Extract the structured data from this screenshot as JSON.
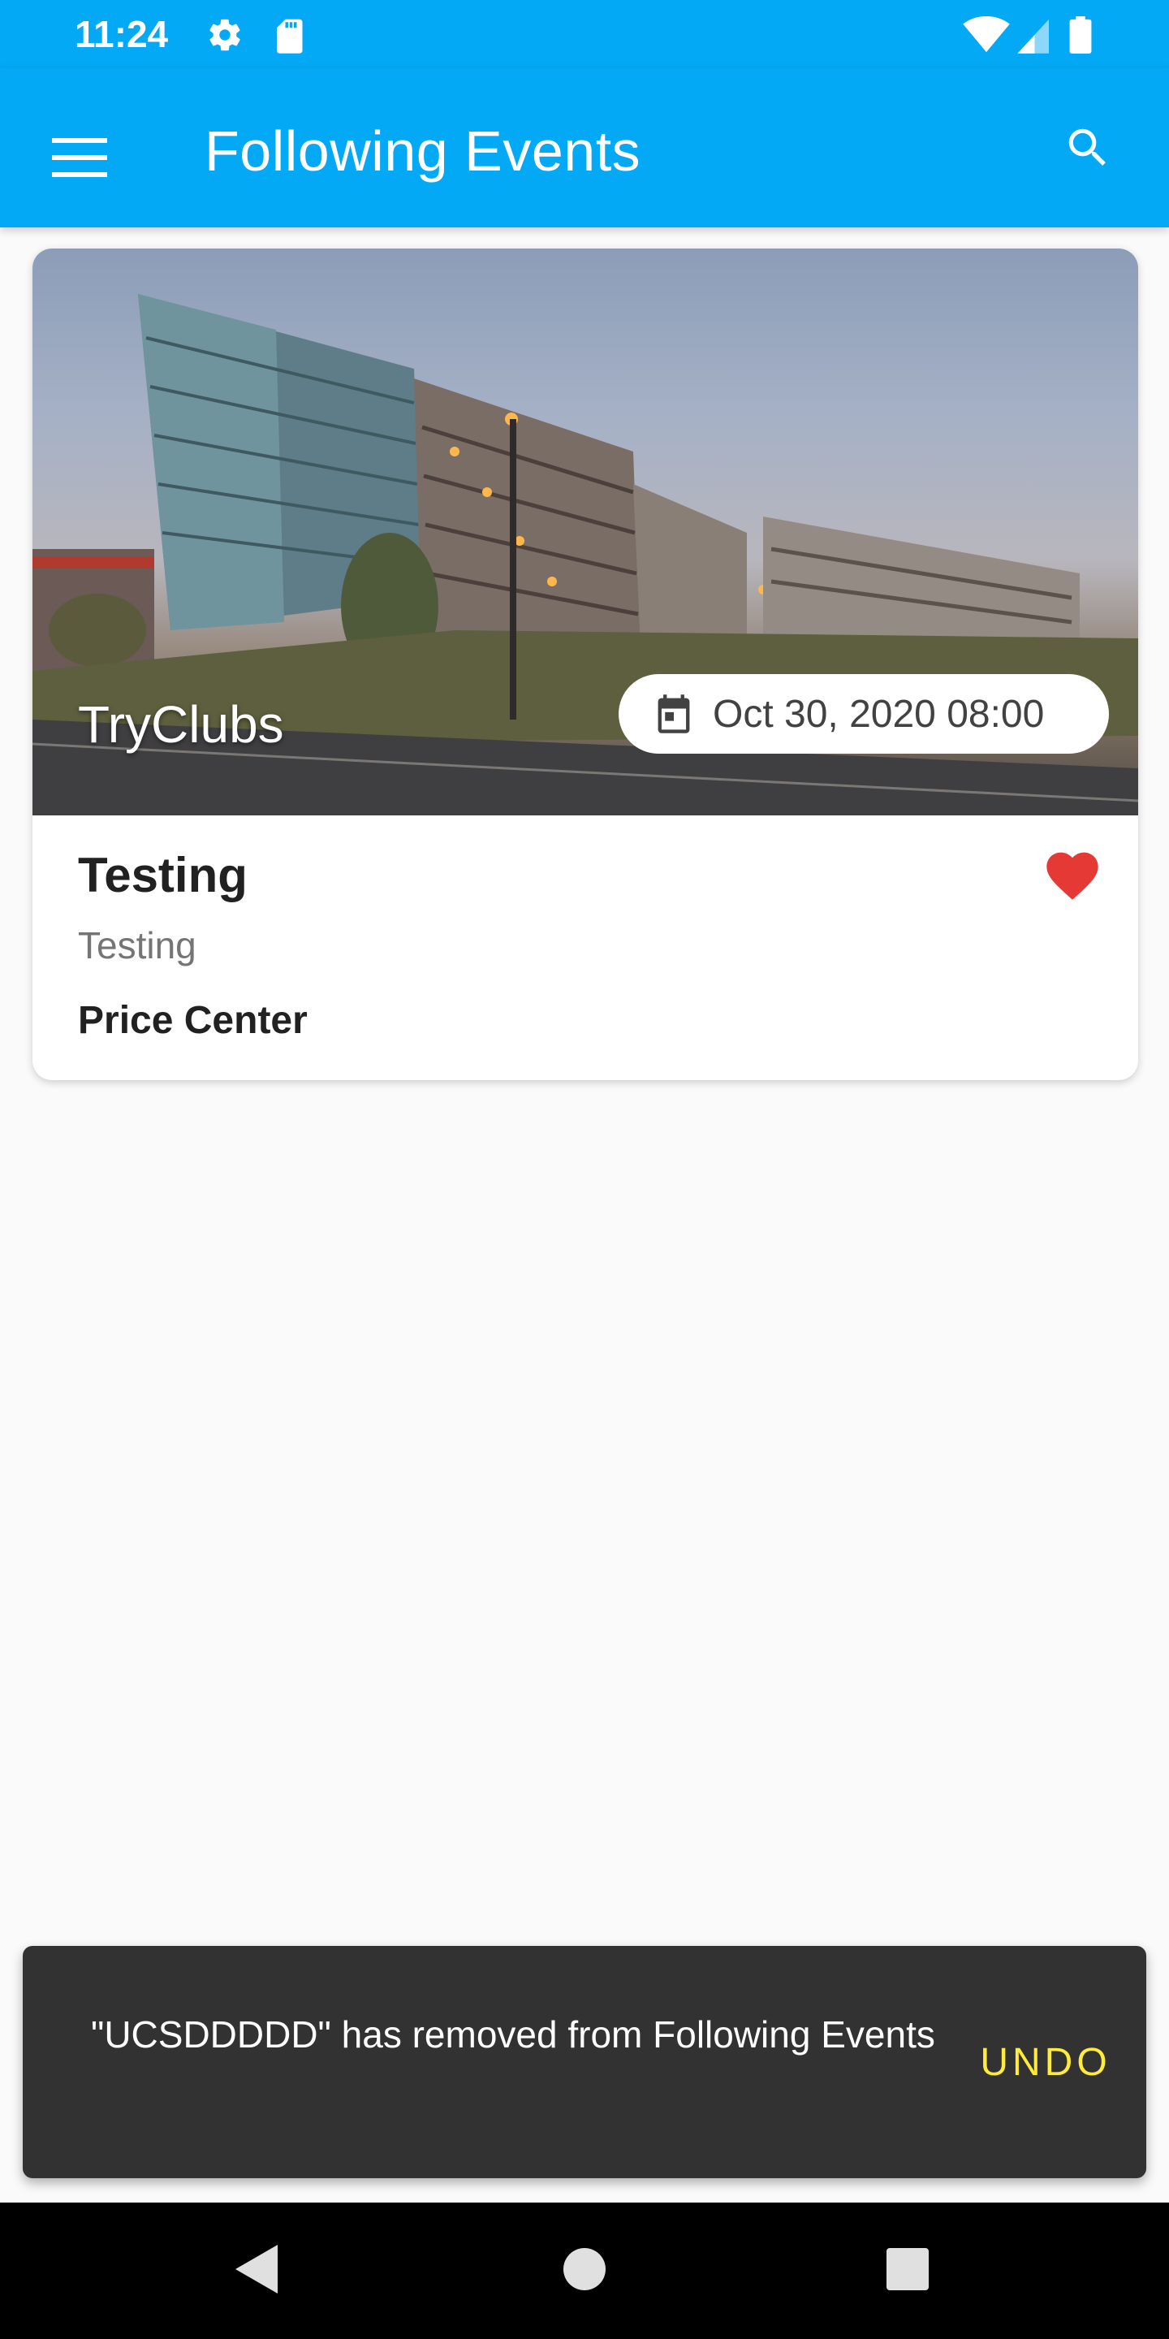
{
  "status_bar": {
    "time": "11:24",
    "icons": [
      "settings-icon",
      "sd-card-icon",
      "wifi-icon",
      "signal-icon",
      "battery-icon"
    ]
  },
  "app_bar": {
    "title": "Following Events",
    "menu_icon": "menu-icon",
    "search_icon": "search-icon",
    "color": "#03a9f4"
  },
  "events": [
    {
      "club": "TryClubs",
      "date": "Oct 30, 2020 08:00",
      "title": "Testing",
      "description": "Testing",
      "location": "Price Center",
      "favorite": true,
      "favorite_color": "#e53935"
    }
  ],
  "snackbar": {
    "message": "\"UCSDDDDD\" has removed from Following Events",
    "action": "UNDO",
    "action_color": "#ffeb3b"
  },
  "nav_bar": {
    "buttons": [
      "back-icon",
      "home-icon",
      "recents-icon"
    ]
  }
}
